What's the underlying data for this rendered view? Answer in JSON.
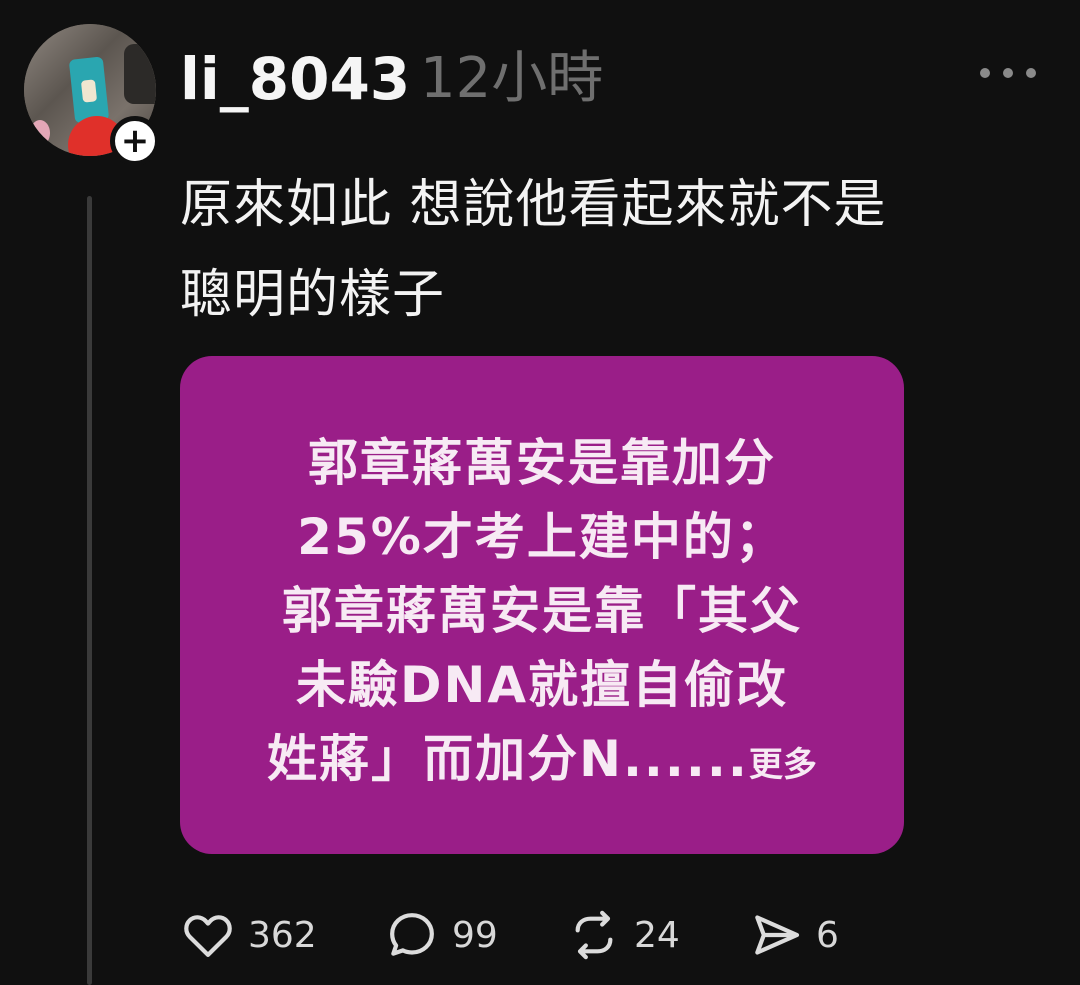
{
  "post": {
    "username": "li_8043",
    "time": "12小時",
    "follow_symbol": "+",
    "text_lines": [
      "原來如此 想說他看起來就不是",
      "聰明的樣子"
    ],
    "image_text": {
      "lines": [
        "郭章蔣萬安是靠加分",
        "25%才考上建中的；",
        "郭章蔣萬安是靠「其父",
        "未驗DNA就擅自偷改",
        "姓蔣」而加分N......"
      ],
      "more_label": "更多",
      "background_color": "#9a1e88"
    },
    "actions": {
      "likes": "362",
      "comments": "99",
      "reposts": "24",
      "shares": "6"
    }
  },
  "icons": {
    "more": "more-horizontal-icon",
    "like": "heart-icon",
    "comment": "comment-bubble-icon",
    "repost": "repost-icon",
    "share": "send-icon"
  }
}
